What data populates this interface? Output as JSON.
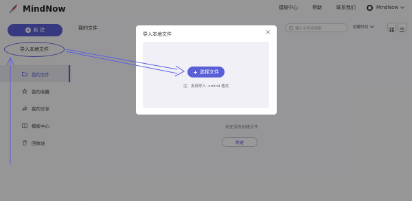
{
  "app": {
    "name": "MindNow"
  },
  "topnav": {
    "templates": "模板中心",
    "help": "帮助",
    "contact": "联系我们",
    "username": "MindNow"
  },
  "sidebar": {
    "new_label": "新 建",
    "import_label": "导入本地文件",
    "items": [
      {
        "label": "我的文件",
        "icon": "folder-icon",
        "active": true
      },
      {
        "label": "我的收藏",
        "icon": "star-icon",
        "active": false
      },
      {
        "label": "我的分享",
        "icon": "share-icon",
        "active": false
      },
      {
        "label": "模板中心",
        "icon": "book-icon",
        "active": false
      },
      {
        "label": "回收站",
        "icon": "trash-icon",
        "active": false
      }
    ]
  },
  "main": {
    "title": "我的文件",
    "search_placeholder": "输入文件名搜索",
    "sort_label": "创建时间",
    "empty_text": "现还没有创建文件",
    "empty_button": "新建"
  },
  "modal": {
    "title": "导入本地文件",
    "choose_button": "选择文件",
    "note": "注：支持导入 .xmind 格式"
  },
  "colors": {
    "accent": "#5b5fd6",
    "annotation": "#5a5ee0"
  }
}
